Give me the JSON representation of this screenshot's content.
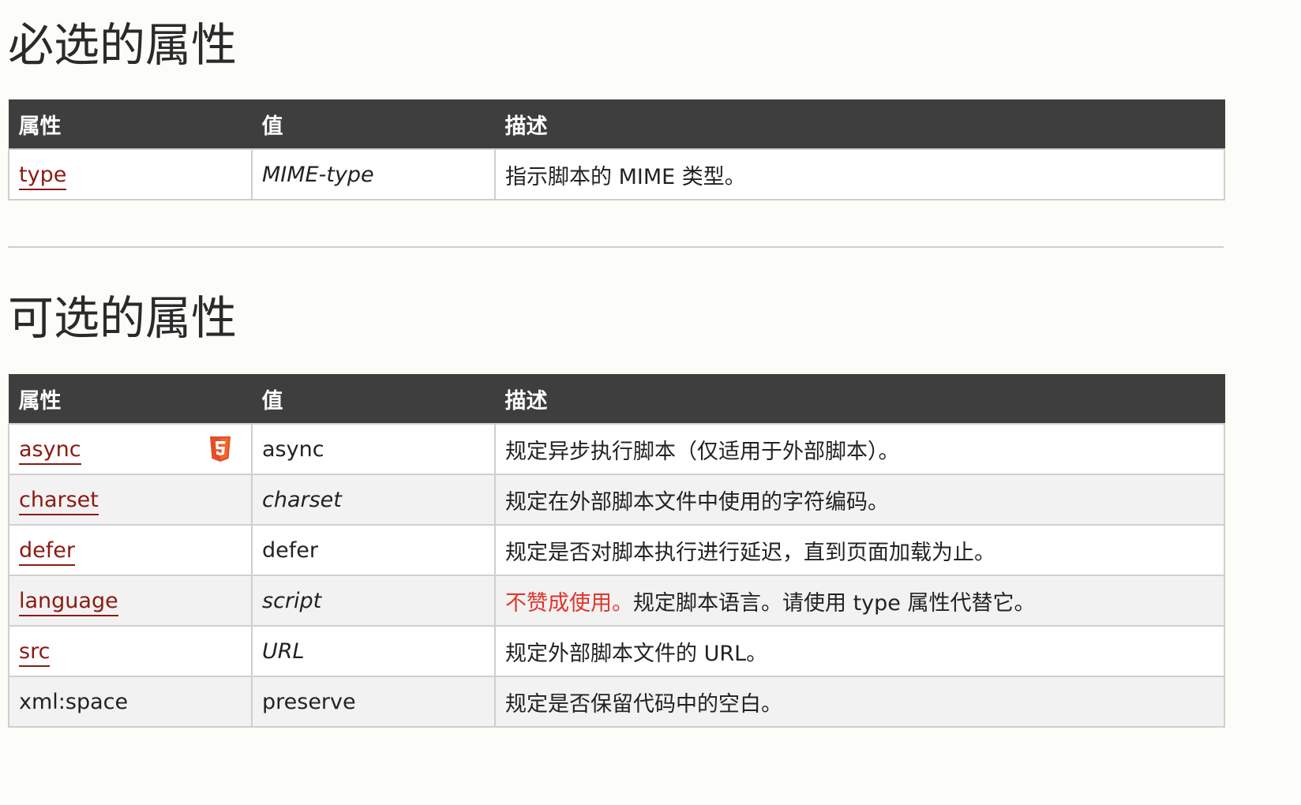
{
  "required": {
    "title": "必选的属性",
    "headers": [
      "属性",
      "值",
      "描述"
    ],
    "rows": [
      {
        "attr": "type",
        "value": "MIME-type",
        "desc": "指示脚本的 MIME 类型。"
      }
    ]
  },
  "optional": {
    "title": "可选的属性",
    "headers": [
      "属性",
      "值",
      "描述"
    ],
    "rows": [
      {
        "attr": "async",
        "value": "async",
        "desc": "规定异步执行脚本（仅适用于外部脚本）。",
        "badge": "html5-icon"
      },
      {
        "attr": "charset",
        "value": "charset",
        "desc": "规定在外部脚本文件中使用的字符编码。"
      },
      {
        "attr": "defer",
        "value": "defer",
        "desc": "规定是否对脚本执行进行延迟，直到页面加载为止。"
      },
      {
        "attr": "language",
        "value": "script",
        "desc_deprecated": "不赞成使用。",
        "desc": "规定脚本语言。请使用 type 属性代替它。"
      },
      {
        "attr": "src",
        "value": "URL",
        "desc": "规定外部脚本文件的 URL。"
      },
      {
        "attr": "xml:space",
        "value": "preserve",
        "desc": "规定是否保留代码中的空白。"
      }
    ]
  },
  "colors": {
    "header_bg": "#3e3e3e",
    "link": "#8b1a12",
    "deprecated": "#e0352b",
    "html5_badge": "#e44d26"
  }
}
